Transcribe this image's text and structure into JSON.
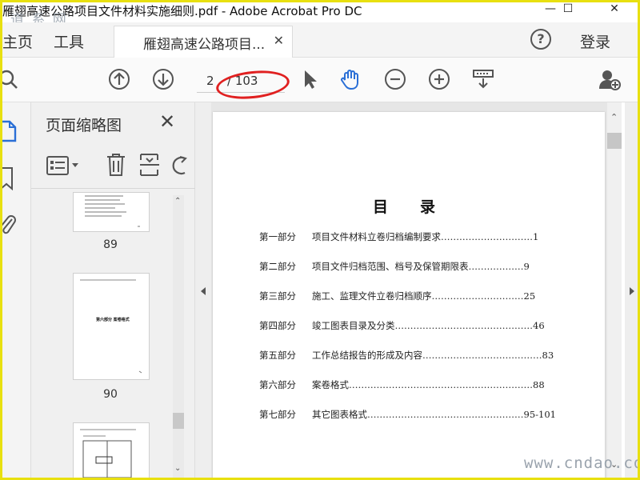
{
  "window": {
    "title": "雁翅高速公路项目文件材料实施细则.pdf - Adobe Acrobat Pro DC",
    "minimize": "—",
    "maximize": "☐",
    "close": "✕"
  },
  "watermark_top": "道 系 网",
  "watermark_bottom": "www.cndao.com",
  "tabs": {
    "home": "主页",
    "tools": "工具",
    "document": "雁翅高速公路项目...",
    "help": "?",
    "login": "登录"
  },
  "toolbar": {
    "current_page": "2",
    "total_pages": "/ 103"
  },
  "thumbnail_panel": {
    "title": "页面缩略图",
    "thumbnails": [
      {
        "page": "89"
      },
      {
        "page": "90",
        "text": "第六部分  案卷格式"
      },
      {
        "page": ""
      }
    ]
  },
  "document": {
    "toc_title": "目录",
    "toc": [
      {
        "part": "第一部分",
        "entry": "项目文件材料立卷归档编制要求…………………………1"
      },
      {
        "part": "第二部分",
        "entry": "项目文件归档范围、档号及保管期限表………………9"
      },
      {
        "part": "第三部分",
        "entry": "施工、监理文件立卷归档顺序…………………………25"
      },
      {
        "part": "第四部分",
        "entry": "竣工图表目录及分类………………………………………46"
      },
      {
        "part": "第五部分",
        "entry": "工作总结报告的形成及内容…………………………………83"
      },
      {
        "part": "第六部分",
        "entry": "案卷格式……………………………………………………88"
      },
      {
        "part": "第七部分",
        "entry": "其它图表格式……………………………………………95-101"
      }
    ]
  },
  "colors": {
    "accent_blue": "#2a6fd6",
    "highlight_red": "#e02020",
    "frame_yellow": "#e8e010"
  }
}
